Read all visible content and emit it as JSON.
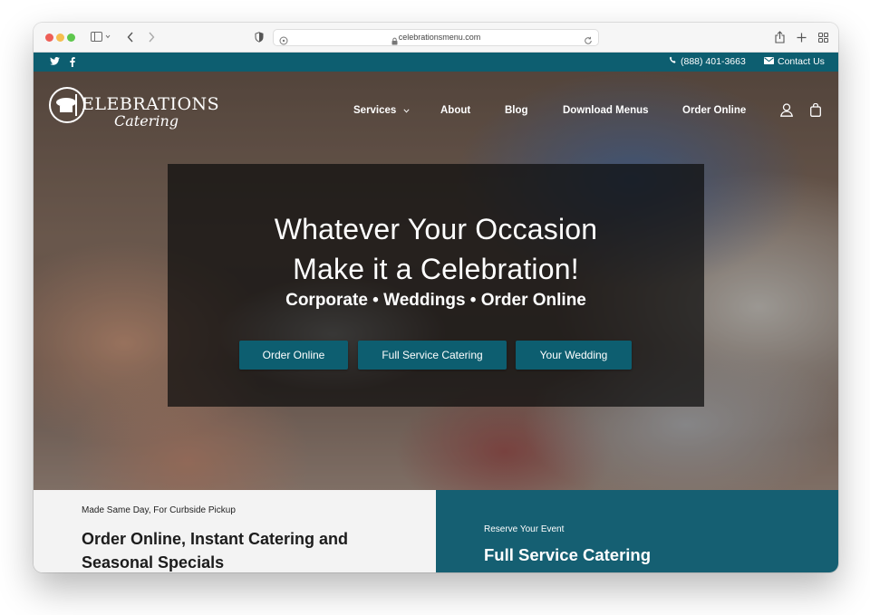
{
  "browser": {
    "url": "celebrationsmenu.com",
    "icons": [
      "sidebar-icon",
      "back-icon",
      "forward-icon",
      "shield-icon",
      "lock-icon",
      "reload-icon",
      "share-icon",
      "new-tab-icon",
      "tab-overview-icon"
    ]
  },
  "topbar": {
    "phone": "(888) 401-3663",
    "contact": "Contact Us",
    "social": [
      "twitter-icon",
      "facebook-icon"
    ]
  },
  "logo": {
    "main": "ELEBRATIONS",
    "sub": "Catering"
  },
  "nav": {
    "items": [
      {
        "label": "Services"
      },
      {
        "label": "About"
      },
      {
        "label": "Blog"
      },
      {
        "label": "Download Menus"
      },
      {
        "label": "Order Online"
      }
    ]
  },
  "hero": {
    "title_line1": "Whatever Your Occasion",
    "title_line2": "Make it a Celebration!",
    "subtitle": "Corporate • Weddings • Order Online",
    "buttons": [
      {
        "label": "Order Online"
      },
      {
        "label": "Full Service Catering"
      },
      {
        "label": "Your Wedding"
      }
    ]
  },
  "panels": {
    "left": {
      "eyebrow": "Made Same Day, For Curbside Pickup",
      "heading": "Order Online, Instant Catering and Seasonal Specials"
    },
    "right": {
      "eyebrow": "Reserve Your Event",
      "heading": "Full Service Catering"
    }
  },
  "colors": {
    "brand_teal": "#0d5e70",
    "panel_teal": "#155f72",
    "panel_light": "#f3f3f3"
  }
}
